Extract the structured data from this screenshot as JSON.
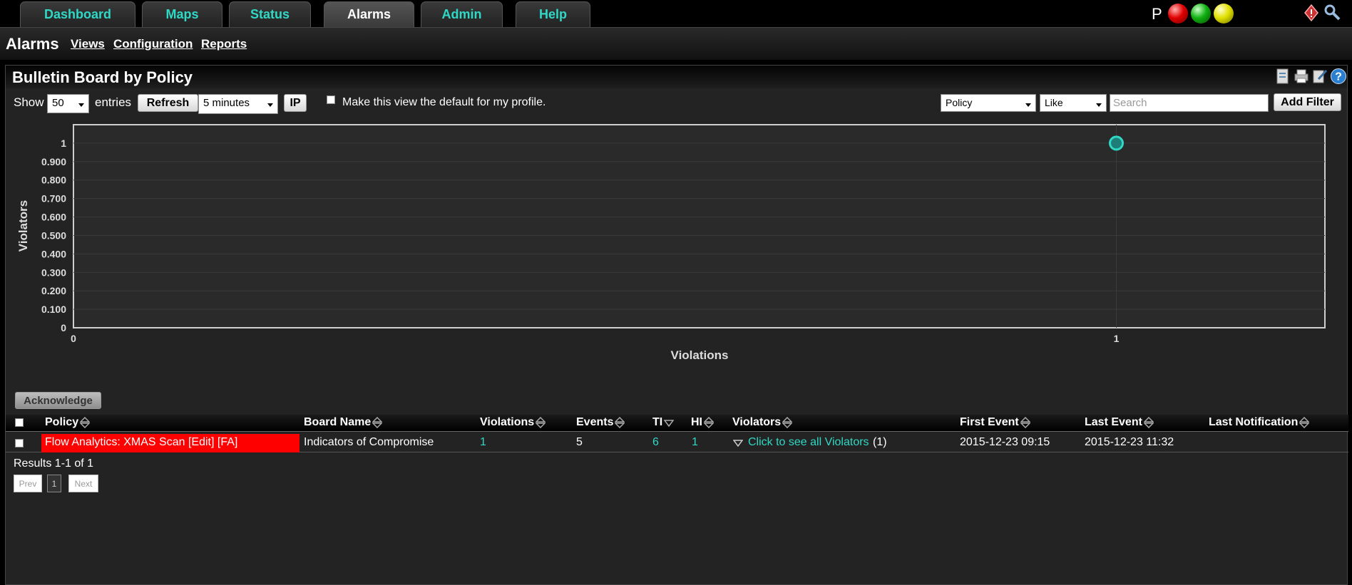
{
  "nav": {
    "tabs": [
      {
        "label": "Dashboard"
      },
      {
        "label": "Maps"
      },
      {
        "label": "Status"
      },
      {
        "label": "Alarms"
      },
      {
        "label": "Admin"
      },
      {
        "label": "Help"
      }
    ],
    "active_tab": "Alarms",
    "status_letter": "P",
    "status_lights": [
      "red",
      "green",
      "yellow"
    ],
    "right_icons": [
      "alert-icon",
      "tools-icon"
    ]
  },
  "subheader": {
    "title": "Alarms",
    "links": [
      "Views",
      "Configuration",
      "Reports"
    ]
  },
  "panel": {
    "title": "Bulletin Board by Policy",
    "header_icons": [
      "report-icon",
      "print-icon",
      "edit-icon",
      "help-icon"
    ]
  },
  "controls": {
    "show_label": "Show",
    "entries_value": "50",
    "entries_label": "entries",
    "refresh_label": "Refresh",
    "interval_value": "5 minutes",
    "ip_label": "IP",
    "default_view_label": "Make this view the default for my profile.",
    "filter_field_value": "Policy",
    "filter_op_value": "Like",
    "search_placeholder": "Search",
    "add_filter_label": "Add Filter"
  },
  "chart_data": {
    "type": "scatter",
    "xlabel": "Violations",
    "ylabel": "Violators",
    "xlim": [
      0,
      1.2
    ],
    "ylim": [
      0,
      1.1
    ],
    "x_ticks": [
      "0",
      "1"
    ],
    "y_ticks": [
      "0",
      "0.100",
      "0.200",
      "0.300",
      "0.400",
      "0.500",
      "0.600",
      "0.700",
      "0.800",
      "0.900",
      "1"
    ],
    "points": [
      {
        "x": 1,
        "y": 1
      }
    ],
    "point_color": "#2fd9c6",
    "grid": true
  },
  "acknowledge_label": "Acknowledge",
  "table": {
    "columns": [
      "Policy",
      "Board Name",
      "Violations",
      "Events",
      "TI",
      "HI",
      "Violators",
      "First Event",
      "Last Event",
      "Last Notification"
    ],
    "rows": [
      {
        "policy": "Flow Analytics: XMAS Scan [Edit] [FA]",
        "board_name": "Indicators of Compromise",
        "violations": "1",
        "events": "5",
        "ti": "6",
        "hi": "1",
        "violators_link": "Click to see all Violators",
        "violators_count": "(1)",
        "first_event": "2015-12-23 09:15",
        "last_event": "2015-12-23 11:32",
        "last_notification": ""
      }
    ],
    "policy_highlight_color": "#ff0000"
  },
  "results_text": "Results 1-1 of 1",
  "pagination": {
    "prev": "Prev",
    "page": "1",
    "next": "Next"
  }
}
